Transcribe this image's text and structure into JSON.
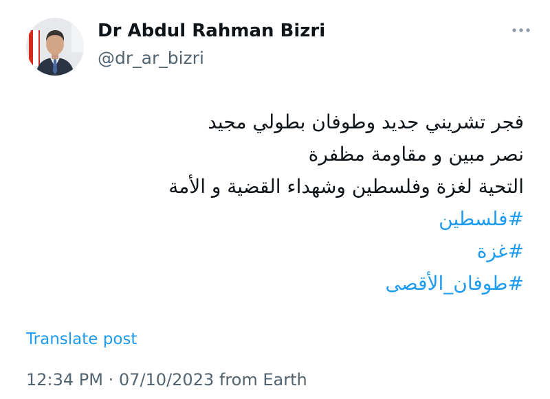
{
  "author": {
    "display_name": "Dr Abdul Rahman Bizri",
    "handle": "@dr_ar_bizri"
  },
  "tweet": {
    "lines": [
      "فجر تشريني جديد وطوفان بطولي مجيد",
      "نصر مبين و مقاومة مظفرة",
      "التحية لغزة وفلسطين وشهداء القضية و الأمة"
    ],
    "hashtags": [
      "#فلسطين",
      "#غزة",
      "#طوفان_الأقصى"
    ]
  },
  "translate_label": "Translate post",
  "meta": {
    "time": "12:34 PM",
    "separator": "·",
    "date": "07/10/2023",
    "source": "from Earth"
  },
  "colors": {
    "link": "#1d9bf0",
    "secondary_text": "#536471",
    "primary_text": "#0f1419"
  },
  "icons": {
    "more": "more-horizontal-icon"
  }
}
